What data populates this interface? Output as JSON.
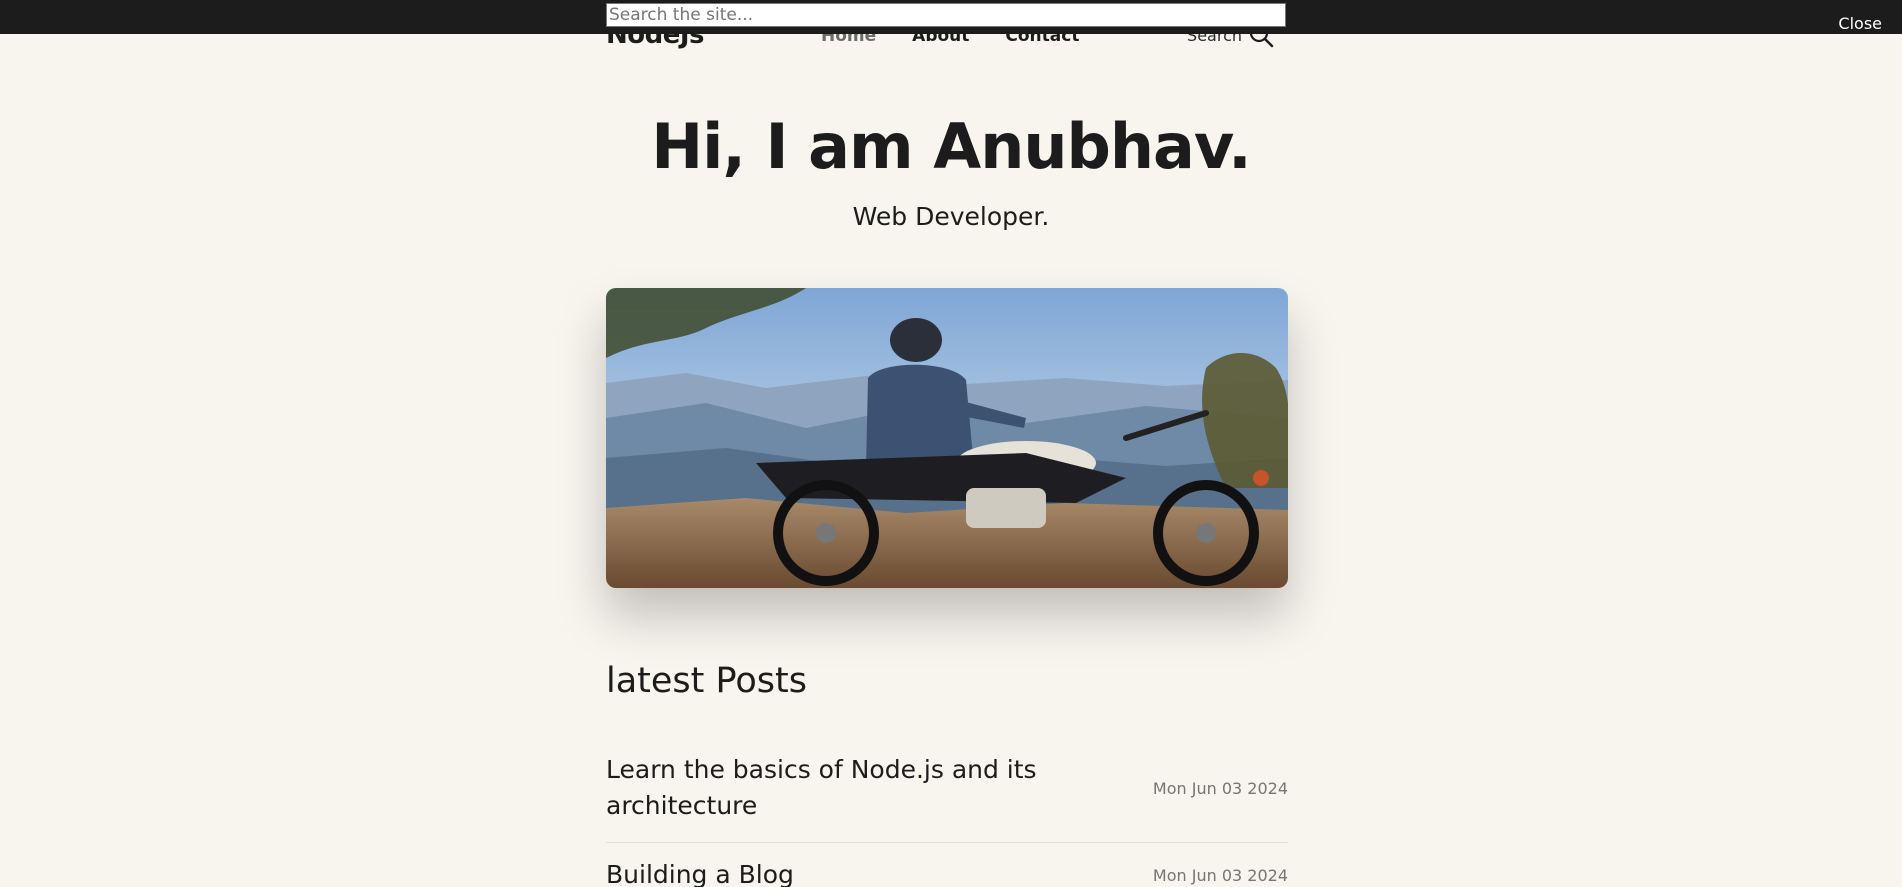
{
  "search_overlay": {
    "placeholder": "Search the site...",
    "close_label": "Close"
  },
  "header": {
    "logo": "NodeJs",
    "nav": [
      {
        "label": "Home",
        "active": true
      },
      {
        "label": "About",
        "active": false
      },
      {
        "label": "Contact",
        "active": false
      }
    ],
    "search_label": "Search",
    "search_icon": "search-icon"
  },
  "hero": {
    "title": "Hi, I am Anubhav.",
    "subtitle": "Web Developer."
  },
  "posts": {
    "heading": "latest Posts",
    "items": [
      {
        "title": "Learn the basics of Node.js and its architecture",
        "date": "Mon Jun 03 2024"
      },
      {
        "title": "Building a Blog",
        "date": "Mon Jun 03 2024"
      }
    ]
  },
  "colors": {
    "background": "#f8f4ee",
    "overlay": "#1c1c1c",
    "text": "#1c1c1c",
    "muted": "#757575"
  }
}
